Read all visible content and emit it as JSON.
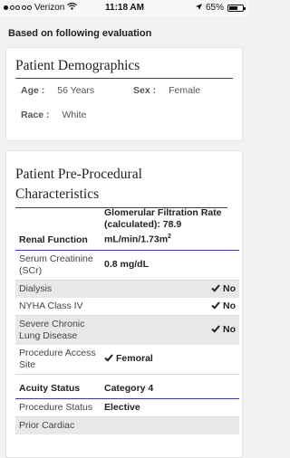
{
  "status_bar": {
    "carrier": "Verizon",
    "time": "11:18 AM",
    "battery": "65%",
    "battery_level": 0.65
  },
  "evaluation_heading": "Based on following evaluation",
  "demographics": {
    "title": "Patient Demographics",
    "age_label": "Age :",
    "age_value": "56 Years",
    "sex_label": "Sex :",
    "sex_value": "Female",
    "race_label": "Race :",
    "race_value": "White"
  },
  "pre_procedural": {
    "title_line1": "Patient Pre-Procedural",
    "title_line2": "Characteristics",
    "renal_header": "Renal Function",
    "gfr_header": "Glomerular Filtration Rate (calculated): 78.9 mL/min/1.73m",
    "gfr_sup": "2",
    "scr_label": "Serum Creatinine (SCr)",
    "scr_value": "0.8 mg/dL",
    "dialysis_label": "Dialysis",
    "dialysis_value": "No",
    "nyha_label": "NYHA Class IV",
    "nyha_value": "No",
    "lung_label": "Severe Chronic Lung Disease",
    "lung_value": "No",
    "access_label": "Procedure Access Site",
    "access_value": "Femoral",
    "acuity_label": "Acuity Status",
    "acuity_value": "Category 4",
    "status_label": "Procedure Status",
    "status_value": "Elective",
    "prior_label": "Prior Cardiac"
  },
  "icons": {
    "check": "check-icon",
    "wifi": "wifi-icon",
    "location": "location-arrow-icon",
    "battery": "battery-icon"
  }
}
